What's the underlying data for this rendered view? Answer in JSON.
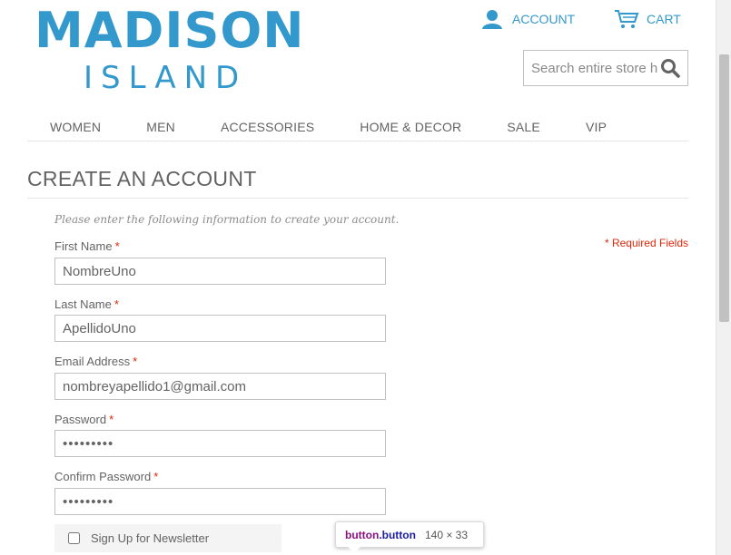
{
  "brand": {
    "line1": "MADISON",
    "line2": "ISLAND",
    "color": "#3399cc"
  },
  "header": {
    "account_label": "ACCOUNT",
    "cart_label": "CART",
    "search_placeholder": "Search entire store here..."
  },
  "nav": {
    "items": [
      "WOMEN",
      "MEN",
      "ACCESSORIES",
      "HOME & DECOR",
      "SALE",
      "VIP"
    ]
  },
  "page": {
    "title": "CREATE AN ACCOUNT",
    "intro": "Please enter the following information to create your account.",
    "required_note": "* Required Fields"
  },
  "form": {
    "first_name": {
      "label": "First Name",
      "value": "NombreUno"
    },
    "last_name": {
      "label": "Last Name",
      "value": "ApellidoUno"
    },
    "email": {
      "label": "Email Address",
      "value": "nombreyapellido1@gmail.com"
    },
    "password": {
      "label": "Password",
      "value": "•••••••••"
    },
    "confirm": {
      "label": "Confirm Password",
      "value": "•••••••••"
    },
    "required_star": "*",
    "newsletter_label": "Sign Up for Newsletter"
  },
  "devtools_tooltip": {
    "tag": "button",
    "class": ".button",
    "size": "140 × 33"
  },
  "colors": {
    "accent": "#3399cc",
    "required": "#df280a",
    "text": "#636363"
  }
}
